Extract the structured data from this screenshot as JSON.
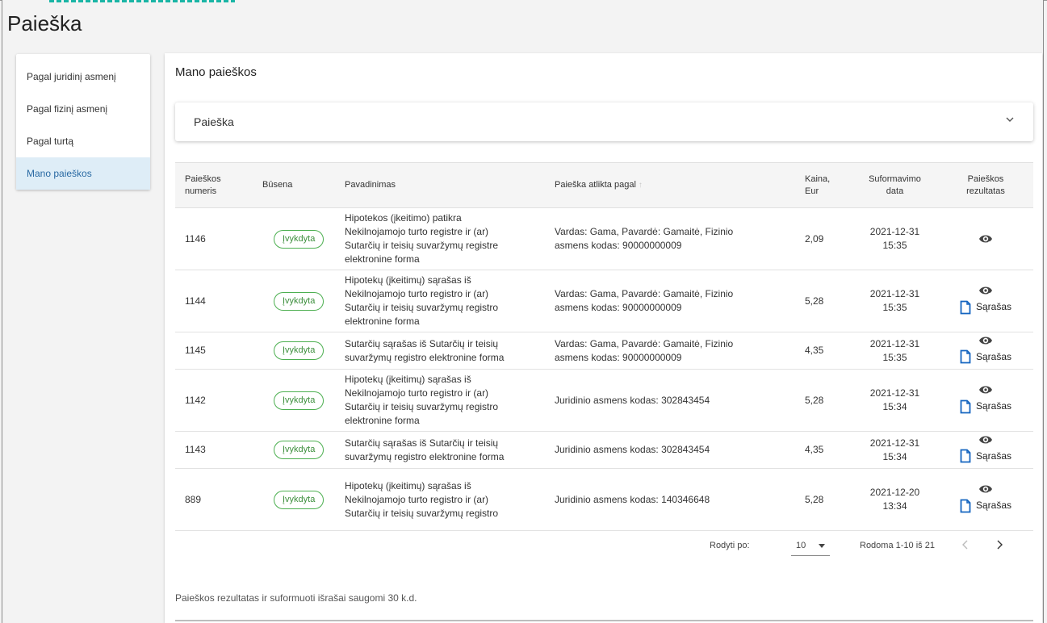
{
  "page": {
    "title": "Paieška"
  },
  "sidebar": {
    "items": [
      {
        "label": "Pagal juridinį asmenį",
        "active": false
      },
      {
        "label": "Pagal fizinį asmenį",
        "active": false
      },
      {
        "label": "Pagal turtą",
        "active": false
      },
      {
        "label": "Mano paieškos",
        "active": true
      }
    ]
  },
  "main": {
    "title": "Mano paieškos",
    "search_panel": {
      "label": "Paieška",
      "icon": "chevron-down-icon"
    }
  },
  "table": {
    "headers": {
      "number_1": "Paieškos",
      "number_2": "numeris",
      "status": "Būsena",
      "name": "Pavadinimas",
      "by": "Paieška atlikta pagal",
      "price_1": "Kaina,",
      "price_2": "Eur",
      "date_1": "Suformavimo",
      "date_2": "data",
      "result_1": "Paieškos",
      "result_2": "rezultatas"
    },
    "rows": [
      {
        "number": "1146",
        "status": "Įvykdyta",
        "name": [
          "Hipotekos (įkeitimo) patikra",
          "Nekilnojamojo turto registre ir (ar)",
          "Sutarčių ir teisių suvaržymų registre",
          "elektronine forma"
        ],
        "by": [
          "Vardas: Gama, Pavardė: Gamaitė, Fizinio",
          "asmens kodas: 90000000009"
        ],
        "price": "2,09",
        "date": "2021-12-31",
        "time": "15:35",
        "list_label": ""
      },
      {
        "number": "1144",
        "status": "Įvykdyta",
        "name": [
          "Hipotekų (įkeitimų) sąrašas iš",
          "Nekilnojamojo turto registro ir (ar)",
          "Sutarčių ir teisių suvaržymų registro",
          "elektronine forma"
        ],
        "by": [
          "Vardas: Gama, Pavardė: Gamaitė, Fizinio",
          "asmens kodas: 90000000009"
        ],
        "price": "5,28",
        "date": "2021-12-31",
        "time": "15:35",
        "list_label": "Sąrašas"
      },
      {
        "number": "1145",
        "status": "Įvykdyta",
        "name": [
          "Sutarčių sąrašas iš Sutarčių ir teisių",
          "suvaržymų registro elektronine forma"
        ],
        "by": [
          "Vardas: Gama, Pavardė: Gamaitė, Fizinio",
          "asmens kodas: 90000000009"
        ],
        "price": "4,35",
        "date": "2021-12-31",
        "time": "15:35",
        "list_label": "Sąrašas"
      },
      {
        "number": "1142",
        "status": "Įvykdyta",
        "name": [
          "Hipotekų (įkeitimų) sąrašas iš",
          "Nekilnojamojo turto registro ir (ar)",
          "Sutarčių ir teisių suvaržymų registro",
          "elektronine forma"
        ],
        "by": [
          "Juridinio asmens kodas: 302843454"
        ],
        "price": "5,28",
        "date": "2021-12-31",
        "time": "15:34",
        "list_label": "Sąrašas"
      },
      {
        "number": "1143",
        "status": "Įvykdyta",
        "name": [
          "Sutarčių sąrašas iš Sutarčių ir teisių",
          "suvaržymų registro elektronine forma"
        ],
        "by": [
          "Juridinio asmens kodas: 302843454"
        ],
        "price": "4,35",
        "date": "2021-12-31",
        "time": "15:34",
        "list_label": "Sąrašas"
      },
      {
        "number": "889",
        "status": "Įvykdyta",
        "name": [
          "Hipotekų (įkeitimų) sąrašas iš",
          "Nekilnojamojo turto registro ir (ar)",
          "Sutarčių ir teisių suvaržymų registro"
        ],
        "by": [
          "Juridinio asmens kodas: 140346648"
        ],
        "price": "5,28",
        "date": "2021-12-20",
        "time": "13:34",
        "list_label": "Sąrašas"
      }
    ]
  },
  "pagination": {
    "rows_label": "Rodyti po:",
    "rows_value": "10",
    "range": "Rodoma 1-10 iš 21"
  },
  "footnote": "Paieškos rezultatas ir suformuoti išrašai saugomi 30 k.d.",
  "colors": {
    "accent": "#2a6aa3",
    "active_bg": "#deedf7",
    "status_green": "#4caf50",
    "top_teal": "#19b5a5"
  }
}
